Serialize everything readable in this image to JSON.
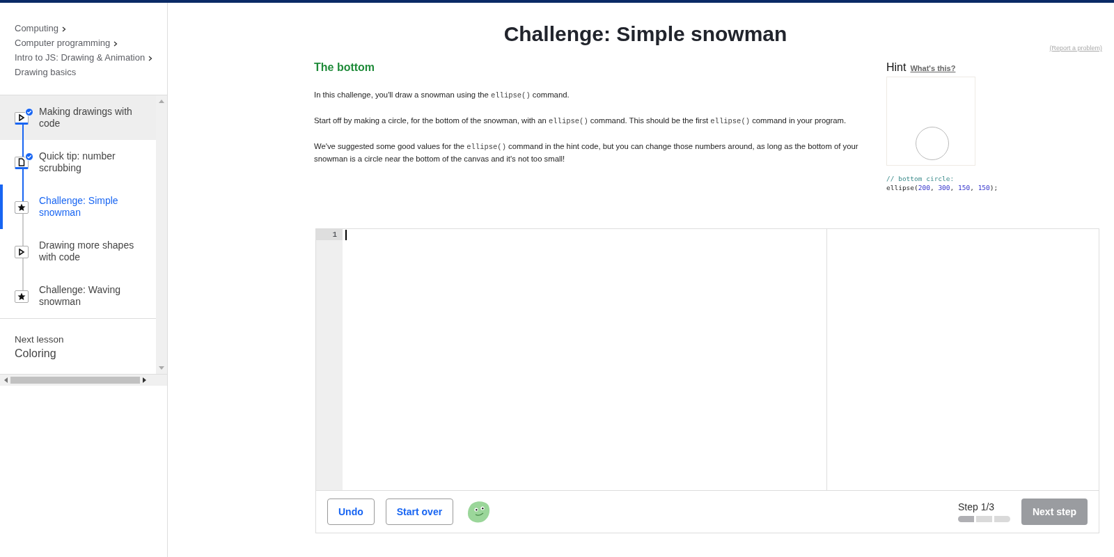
{
  "breadcrumbs": [
    "Computing",
    "Computer programming",
    "Intro to JS: Drawing & Animation",
    "Drawing basics"
  ],
  "lessons": [
    {
      "title": "Making drawings with code",
      "kind": "video",
      "completed": true,
      "selected": false,
      "hovered": true
    },
    {
      "title": "Quick tip: number scrubbing",
      "kind": "article",
      "completed": true,
      "selected": false,
      "hovered": false
    },
    {
      "title": "Challenge: Simple snowman",
      "kind": "challenge",
      "completed": false,
      "selected": true,
      "hovered": false
    },
    {
      "title": "Drawing more shapes with code",
      "kind": "video",
      "completed": false,
      "selected": false,
      "hovered": false
    },
    {
      "title": "Challenge: Waving snowman",
      "kind": "challenge",
      "completed": false,
      "selected": false,
      "hovered": false
    }
  ],
  "next_lesson": {
    "label": "Next lesson",
    "title": "Coloring"
  },
  "title": "Challenge: Simple snowman",
  "report_link": "(Report a problem)",
  "step_heading": "The bottom",
  "paragraphs": [
    [
      {
        "text": "In this challenge, you'll draw a snowman using the ",
        "code": false
      },
      {
        "text": "ellipse()",
        "code": true
      },
      {
        "text": " command.",
        "code": false
      }
    ],
    [
      {
        "text": "Start off by making a circle, for the bottom of the snowman, with an ",
        "code": false
      },
      {
        "text": "ellipse()",
        "code": true
      },
      {
        "text": " command. This should be the first ",
        "code": false
      },
      {
        "text": "ellipse()",
        "code": true
      },
      {
        "text": " command in your program.",
        "code": false
      }
    ],
    [
      {
        "text": "We've suggested some good values for the ",
        "code": false
      },
      {
        "text": "ellipse()",
        "code": true
      },
      {
        "text": " command in the hint code, but you can change those numbers around, as long as the bottom of your snowman is a circle near the bottom of the canvas and it's not too small!",
        "code": false
      }
    ]
  ],
  "hint": {
    "label": "Hint",
    "help_link": "What's this?",
    "code_lines": [
      [
        {
          "text": "// bottom circle:",
          "kind": "comment"
        }
      ],
      [
        {
          "text": "ellipse(",
          "kind": "plain"
        },
        {
          "text": "200",
          "kind": "number"
        },
        {
          "text": ", ",
          "kind": "plain"
        },
        {
          "text": "300",
          "kind": "number"
        },
        {
          "text": ", ",
          "kind": "plain"
        },
        {
          "text": "150",
          "kind": "number"
        },
        {
          "text": ", ",
          "kind": "plain"
        },
        {
          "text": "150",
          "kind": "number"
        },
        {
          "text": ");",
          "kind": "plain"
        }
      ]
    ]
  },
  "editor": {
    "line_numbers": [
      "1"
    ]
  },
  "footer": {
    "buttons": [
      "Undo",
      "Start over"
    ],
    "step_label": "Step 1/3",
    "steps": [
      {
        "done": true
      },
      {
        "done": false
      },
      {
        "done": false
      }
    ],
    "next_button": {
      "label": "Next step",
      "disabled": true
    }
  }
}
